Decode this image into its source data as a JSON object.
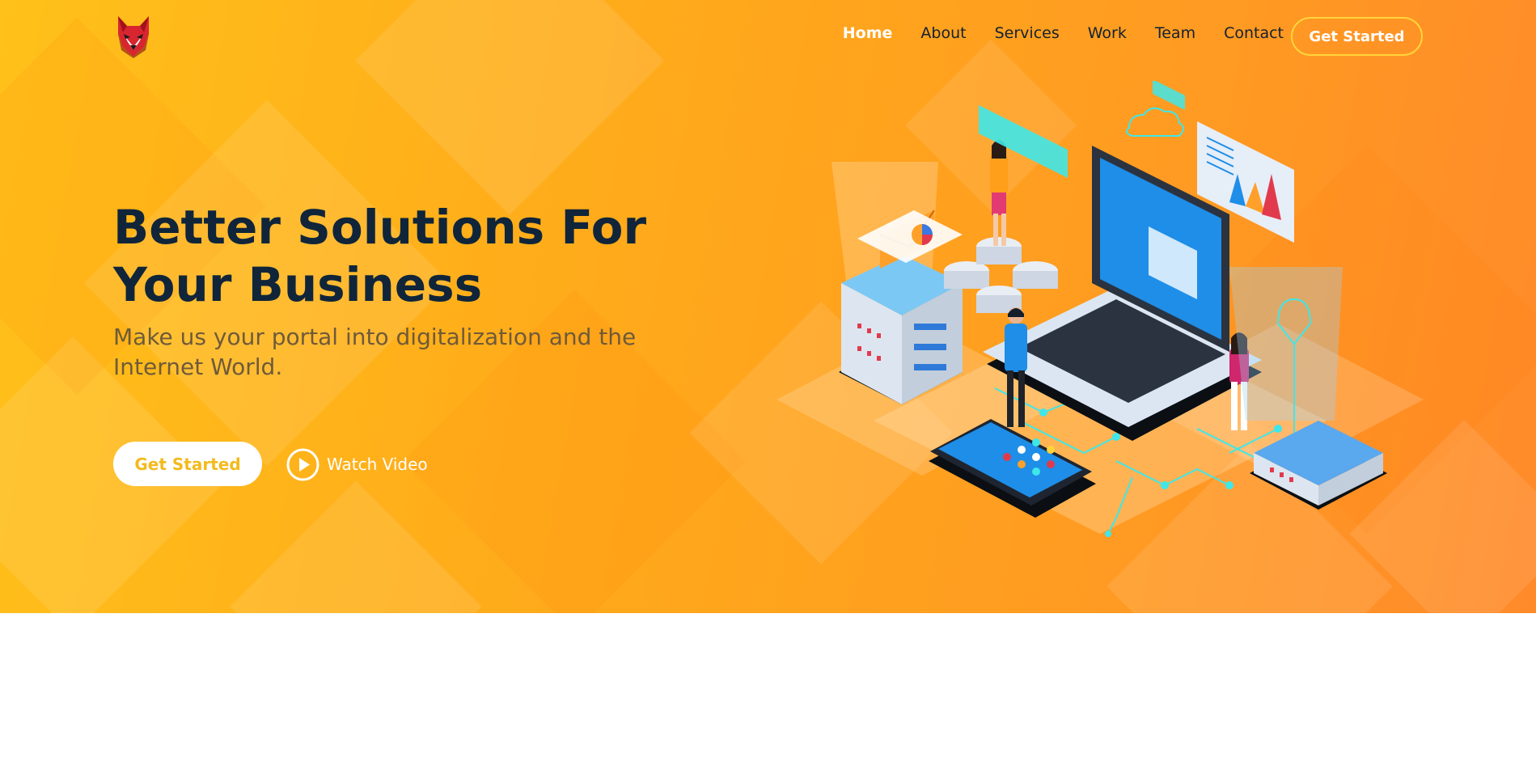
{
  "nav": {
    "logo_icon": "wolf-logo-icon",
    "links": [
      "Home",
      "About",
      "Services",
      "Work",
      "Team",
      "Contact"
    ],
    "active_link": "Home",
    "cta_label": "Get Started"
  },
  "hero": {
    "title": "Better Solutions For Your Business",
    "subtitle": "Make us your portal into digitalization and the Internet World.",
    "primary_button": "Get Started",
    "video_button": "Watch Video",
    "video_icon": "play-circle-icon",
    "illustration": "isometric-technology-illustration"
  },
  "colors": {
    "hero_gradient_start": "#ffc11a",
    "hero_gradient_end": "#ff8a2a",
    "heading": "#10253a",
    "accent": "#f3ba1e",
    "nav_cta_border": "#ffd43a"
  }
}
